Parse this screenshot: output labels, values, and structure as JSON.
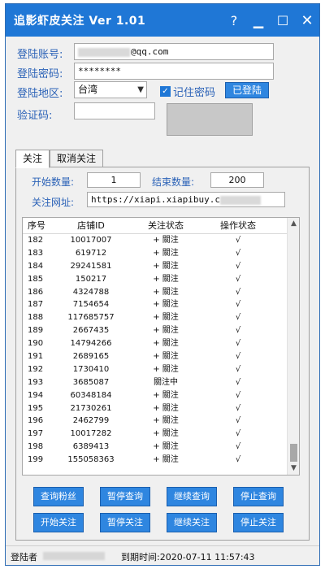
{
  "window": {
    "title": "追影虾皮关注 Ver 1.01",
    "controls": {
      "help": "?",
      "minimize": "▁",
      "maximize": "☐",
      "close": "✕"
    }
  },
  "login": {
    "account_label": "登陆账号:",
    "account_value_suffix": "@qq.com",
    "password_label": "登陆密码:",
    "password_value": "********",
    "region_label": "登陆地区:",
    "region_value": "台湾",
    "remember_label": "记住密码",
    "remember_checked": true,
    "login_button": "已登陆",
    "captcha_label": "验证码:",
    "captcha_value": ""
  },
  "tabs": [
    {
      "label": "关注",
      "active": true
    },
    {
      "label": "取消关注",
      "active": false
    }
  ],
  "follow": {
    "start_label": "开始数量:",
    "start_value": "1",
    "end_label": "结束数量:",
    "end_value": "200",
    "url_label": "关注网址:",
    "url_value": "https://xiapi.xiapibuy.c"
  },
  "table": {
    "headers": [
      "序号",
      "店铺ID",
      "关注状态",
      "操作状态"
    ],
    "rows": [
      [
        "182",
        "10017007",
        "+ 關注",
        "√"
      ],
      [
        "183",
        "619712",
        "+ 關注",
        "√"
      ],
      [
        "184",
        "29241581",
        "+ 關注",
        "√"
      ],
      [
        "185",
        "150217",
        "+ 關注",
        "√"
      ],
      [
        "186",
        "4324788",
        "+ 關注",
        "√"
      ],
      [
        "187",
        "7154654",
        "+ 關注",
        "√"
      ],
      [
        "188",
        "117685757",
        "+ 關注",
        "√"
      ],
      [
        "189",
        "2667435",
        "+ 關注",
        "√"
      ],
      [
        "190",
        "14794266",
        "+ 關注",
        "√"
      ],
      [
        "191",
        "2689165",
        "+ 關注",
        "√"
      ],
      [
        "192",
        "1730410",
        "+ 關注",
        "√"
      ],
      [
        "193",
        "3685087",
        "關注中",
        "√"
      ],
      [
        "194",
        "60348184",
        "+ 關注",
        "√"
      ],
      [
        "195",
        "21730261",
        "+ 關注",
        "√"
      ],
      [
        "196",
        "2462799",
        "+ 關注",
        "√"
      ],
      [
        "197",
        "10017282",
        "+ 關注",
        "√"
      ],
      [
        "198",
        "6389413",
        "+ 關注",
        "√"
      ],
      [
        "199",
        "155058363",
        "+ 關注",
        "√"
      ]
    ]
  },
  "buttons": {
    "query_fans": "查询粉丝",
    "pause_query": "暂停查询",
    "continue_query": "继续查询",
    "stop_query": "停止查询",
    "start_follow": "开始关注",
    "pause_follow": "暂停关注",
    "continue_follow": "继续关注",
    "stop_follow": "停止关注"
  },
  "status": {
    "logged_in_label": "登陆者",
    "expire": "到期时间:2020-07-11 11:57:43"
  },
  "colors": {
    "titlebar": "#1f77d6",
    "label": "#2b62b7",
    "button": "#2f86e0"
  }
}
